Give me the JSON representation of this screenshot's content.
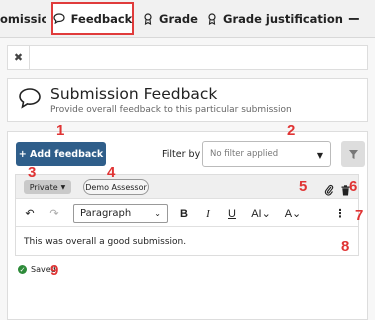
{
  "tabs": {
    "partial_label": "omission",
    "feedback_label": "Feedback",
    "grade_label": "Grade",
    "justification_label": "Grade justification",
    "minus_label": "−"
  },
  "closebar": {
    "close_label": "✖"
  },
  "header_card": {
    "title": "Submission Feedback",
    "subtitle": "Provide overall feedback to this particular submission"
  },
  "panel": {
    "add_button": "+ Add feedback",
    "filter_label": "Filter by",
    "filter_placeholder": "No filter applied",
    "feedback": {
      "visibility": "Private",
      "assessor": "Demo Assessor",
      "paragraph_style": "Paragraph",
      "text": "This was overall a good submission."
    },
    "saved_label": "Saved"
  },
  "annotations": [
    "1",
    "2",
    "3",
    "4",
    "5",
    "6",
    "7",
    "8",
    "9"
  ],
  "colors": {
    "primary": "#2f5e8a",
    "annotation": "#e03434",
    "active_tab_border": "#e03b3b",
    "saved": "#2e8b3a"
  }
}
